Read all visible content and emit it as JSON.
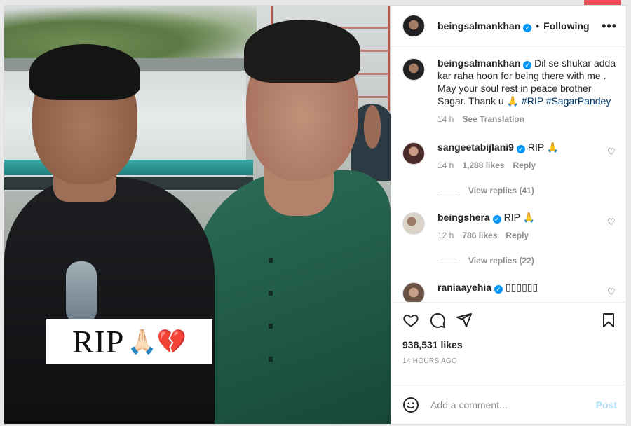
{
  "post": {
    "image_overlay": {
      "text": "RIP",
      "emoji": "🙏🏻💔"
    }
  },
  "header": {
    "username": "beingsalmankhan",
    "separator": "•",
    "follow_status": "Following",
    "more": "•••"
  },
  "caption": {
    "username": "beingsalmankhan",
    "text": "Dil se shukar adda kar raha hoon for being there with me . May your soul rest in peace brother Sagar. Thank u 🙏",
    "hashtags": [
      "#RIP",
      "#SagarPandey"
    ],
    "time": "14 h",
    "translate": "See Translation"
  },
  "comments": [
    {
      "username": "sangeetabijlani9",
      "text": "RIP 🙏",
      "time": "14 h",
      "likes": "1,288 likes",
      "reply": "Reply",
      "view_replies": "View replies (41)"
    },
    {
      "username": "beingshera",
      "text": "RIP 🙏",
      "time": "12 h",
      "likes": "786 likes",
      "reply": "Reply",
      "view_replies": "View replies (22)"
    },
    {
      "username": "raniaayehia",
      "text": "▯▯▯▯▯▯"
    }
  ],
  "actions": {
    "likes": "938,531 likes",
    "timestamp": "14 HOURS AGO"
  },
  "add_comment": {
    "placeholder": "Add a comment...",
    "post_label": "Post"
  },
  "colors": {
    "accent": "#0095f6",
    "hashtag": "#00376b",
    "notification": "#ed4956"
  }
}
